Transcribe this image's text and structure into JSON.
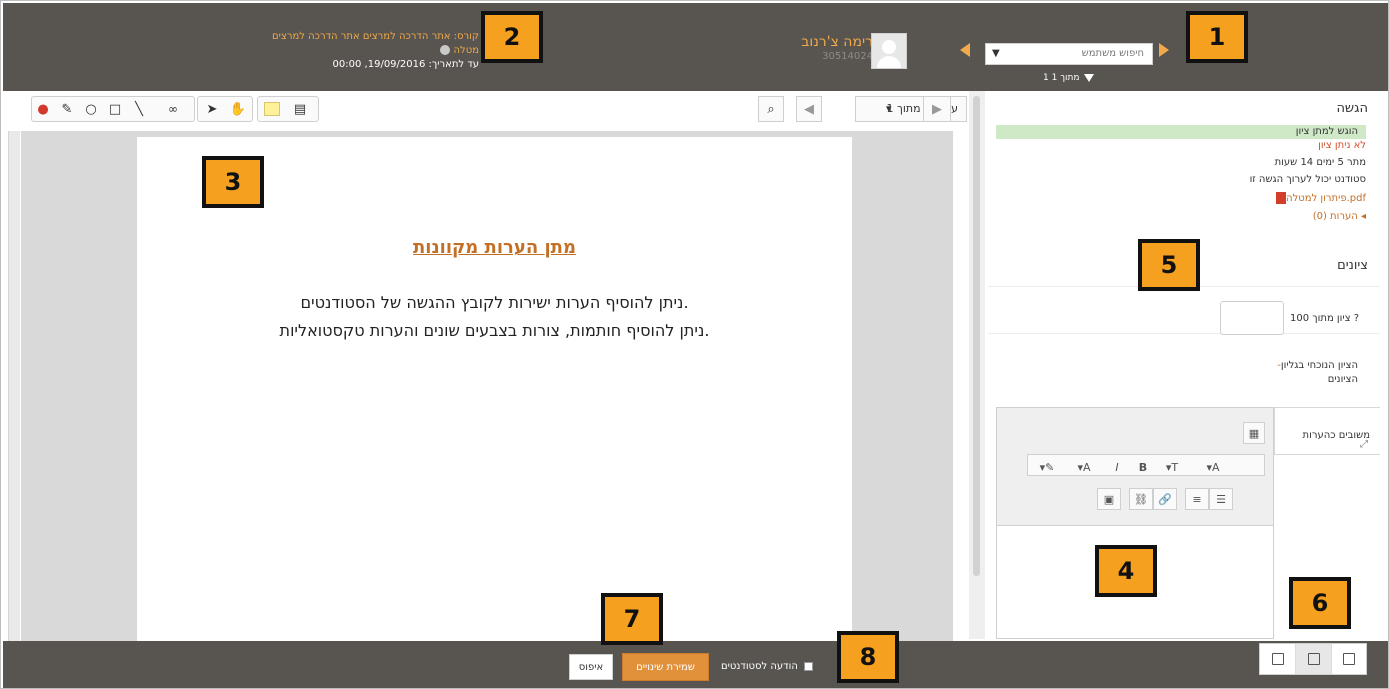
{
  "header": {
    "course_line1": "קורס: אתר הדרכה למרצים אתר הדרכה למרצים",
    "course_line2": "מטלה",
    "course_line3": "עד לתאריך: 19/09/2016, 00:00",
    "user_name": "רימה צ'רנוב",
    "user_id": "30514024",
    "search_placeholder": "חיפוש משתמש",
    "filter_label": "1 מתוך 1"
  },
  "toolbar": {
    "page_label": "עמוד 1 מתוך 1"
  },
  "document": {
    "title": "מתן הערות מקוונות",
    "line1": "ניתן להוסיף הערות ישירות לקובץ ההגשה של הסטודנטים.",
    "line2": "ניתן להוסיף חותמות, צורות בצבעים שונים והערות טקסטואליות."
  },
  "right": {
    "submission_title": "הגשה",
    "status_submitted": "הוגש למתן ציון",
    "status_ungraded": "לא ניתן ציון",
    "status_remaining": "מתר 5 ימים 14 שעות",
    "status_editable": "סטודנט יכול לערוך הגשה זו",
    "file_name": "פיתרון למטלה.pdf",
    "comments_link": "הערות (0)",
    "grades_title": "ציונים",
    "grade_label": "ציון מתוך 100",
    "gradebook_line1": "הציון הנוכחי בגליון",
    "gradebook_line2": "הציונים",
    "feedback_tab": "משובים כהערות"
  },
  "footer": {
    "reset_label": "איפוס",
    "save_label": "שמירת שינויים",
    "notify_label": "הודעה לסטודנטים"
  },
  "callouts": {
    "c1": "1",
    "c2": "2",
    "c3": "3",
    "c4": "4",
    "c5": "5",
    "c6": "6",
    "c7": "7",
    "c8": "8"
  },
  "colors": {
    "topbar": "#585450",
    "accent": "#f0a94b",
    "callout": "#f5a11f",
    "status_ok": "#cfe9c7"
  }
}
